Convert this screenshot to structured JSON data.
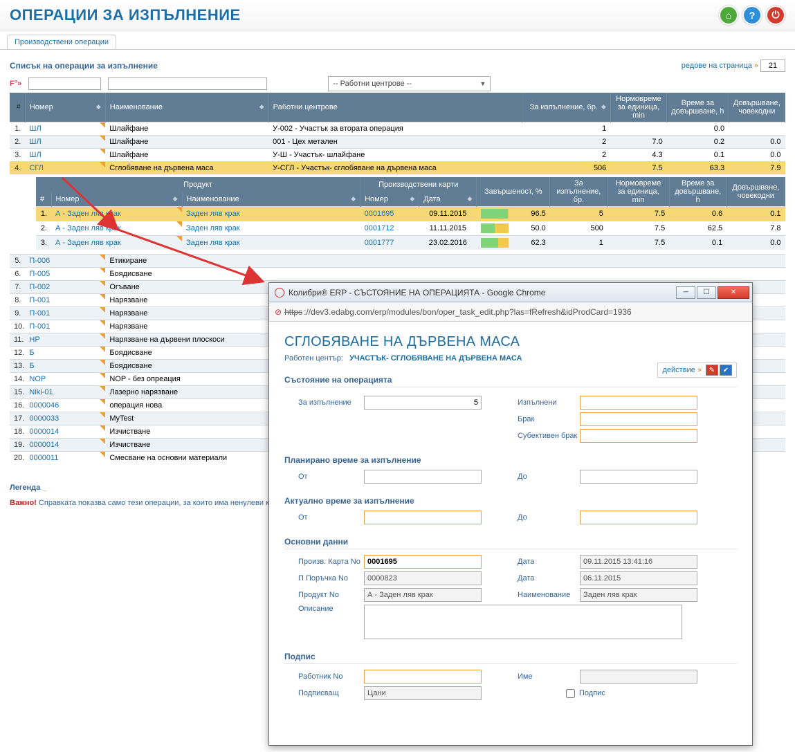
{
  "header": {
    "title": "ОПЕРАЦИИ ЗА ИЗПЪЛНЕНИЕ",
    "icons": {
      "home": "⌂",
      "help": "?",
      "power": "⏻"
    }
  },
  "tab": "Производствени операции",
  "subtitle": "Списък на операции за изпълнение",
  "rows_per_page": {
    "label": "редове на страница",
    "caret": "»",
    "value": "21"
  },
  "filters": {
    "label": "F°»",
    "work_center_placeholder": "-- Работни центрове --"
  },
  "main_columns": {
    "idx": "#",
    "number": "Номер",
    "name": "Наименование",
    "work_centers": "Работни центрове",
    "qty": "За изпълнение, бр.",
    "norm_time": "Нормовреме за единица, min",
    "finish_time": "Време за довършване, h",
    "finish_md": "Довършване, човекодни"
  },
  "main_rows": [
    {
      "idx": "1.",
      "num": "ШЛ",
      "name": "Шлайфане",
      "wc": "У-002 - Участък за втората операция",
      "qty": "1",
      "norm": "",
      "ft": "0.0",
      "md": ""
    },
    {
      "idx": "2.",
      "num": "ШЛ",
      "name": "Шлайфане",
      "wc": "001 - Цех метален",
      "qty": "2",
      "norm": "7.0",
      "ft": "0.2",
      "md": "0.0"
    },
    {
      "idx": "3.",
      "num": "ШЛ",
      "name": "Шлайфане",
      "wc": "У-Ш - Участък- шлайфане",
      "qty": "2",
      "norm": "4.3",
      "ft": "0.1",
      "md": "0.0"
    },
    {
      "idx": "4.",
      "num": "СГЛ",
      "name": "Сглобяване на дървена маса",
      "wc": "У-СГЛ - Участък- сглобяване на дървена маса",
      "qty": "506",
      "norm": "7.5",
      "ft": "63.3",
      "md": "7.9",
      "selected": true
    }
  ],
  "nested_columns": {
    "product": "Продукт",
    "cards": "Производствени карти",
    "idx": "#",
    "number": "Номер",
    "name": "Наименование",
    "card_no": "Номер",
    "date": "Дата",
    "pct": "Завършеност, %",
    "qty": "За изпълнение, бр.",
    "norm": "Нормовреме за единица, min",
    "ft": "Време за довършване, h",
    "md": "Довършване, човекодни"
  },
  "nested_rows": [
    {
      "idx": "1.",
      "pnum": "А - Заден ляв крак",
      "pname": "Заден ляв крак",
      "cnum": "0001695",
      "date": "09.11.2015",
      "pct": "96.5",
      "pct_fill": 97,
      "qty": "5",
      "norm": "7.5",
      "ft": "0.6",
      "md": "0.1",
      "selected": true
    },
    {
      "idx": "2.",
      "pnum": "А - Заден ляв крак",
      "pname": "Заден ляв крак",
      "cnum": "0001712",
      "date": "11.11.2015",
      "pct": "50.0",
      "pct_fill": 50,
      "qty": "500",
      "norm": "7.5",
      "ft": "62.5",
      "md": "7.8"
    },
    {
      "idx": "3.",
      "pnum": "А - Заден ляв крак",
      "pname": "Заден ляв крак",
      "cnum": "0001777",
      "date": "23.02.2016",
      "pct": "62.3",
      "pct_fill": 62,
      "qty": "1",
      "norm": "7.5",
      "ft": "0.1",
      "md": "0.0"
    }
  ],
  "tail_rows": [
    {
      "idx": "5.",
      "num": "П-006",
      "name": "Етикиране"
    },
    {
      "idx": "6.",
      "num": "П-005",
      "name": "Боядисване"
    },
    {
      "idx": "7.",
      "num": "П-002",
      "name": "Огъване"
    },
    {
      "idx": "8.",
      "num": "П-001",
      "name": "Нарязване"
    },
    {
      "idx": "9.",
      "num": "П-001",
      "name": "Нарязване"
    },
    {
      "idx": "10.",
      "num": "П-001",
      "name": "Нарязване"
    },
    {
      "idx": "11.",
      "num": "НР",
      "name": "Нарязване на дървени плоскоси"
    },
    {
      "idx": "12.",
      "num": "Б",
      "name": "Боядисване"
    },
    {
      "idx": "13.",
      "num": "Б",
      "name": "Боядисване"
    },
    {
      "idx": "14.",
      "num": "NOP",
      "name": "NOP - без опреация"
    },
    {
      "idx": "15.",
      "num": "Niki-01",
      "name": "Лазерно нарязване"
    },
    {
      "idx": "16.",
      "num": "0000046",
      "name": "операция нова"
    },
    {
      "idx": "17.",
      "num": "0000033",
      "name": "MyTest"
    },
    {
      "idx": "18.",
      "num": "0000014",
      "name": "Изчистване"
    },
    {
      "idx": "19.",
      "num": "0000014",
      "name": "Изчистване"
    },
    {
      "idx": "20.",
      "num": "0000011",
      "name": "Смесване на основни материали"
    }
  ],
  "legend": {
    "label": "Легенда",
    "bar": "_"
  },
  "note": {
    "strong": "Важно!",
    "text": "Справката показва само тези операции, за които има ненулеви к"
  },
  "popup": {
    "title": "Колибри® ERP - СЪСТОЯНИЕ НА ОПЕРАЦИЯТА - Google Chrome",
    "https": "https",
    "url": "://dev3.edabg.com/erp/modules/bon/oper_task_edit.php?las=fRefresh&idProdCard=1936",
    "op_title": "СГЛОБЯВАНЕ НА ДЪРВЕНА МАСА",
    "wc_label": "Работен център:",
    "wc_value": "УЧАСТЪК- СГЛОБЯВАНЕ НА ДЪРВЕНА МАСА",
    "sections": {
      "status": "Състояние на операцията",
      "planned": "Планирано време за изпълнение",
      "actual": "Актуално време за изпълнение",
      "basic": "Основни данни",
      "sign": "Подпис"
    },
    "action": {
      "label": "действие",
      "caret": "»"
    },
    "fields": {
      "to_exec": "За изпълнение",
      "to_exec_val": "5",
      "done": "Изпълнени",
      "scrap": "Брак",
      "subj_scrap": "Субективен брак",
      "from": "От",
      "to": "До",
      "card_no_l": "Произв. Карта No",
      "card_no_v": "0001695",
      "date_l": "Дата",
      "date_v": "09.11.2015 13:41:16",
      "order_no_l": "П Поръчка No",
      "order_no_v": "0000823",
      "order_date_v": "06.11.2015",
      "prod_no_l": "Продукт No",
      "prod_no_v": "А - Заден ляв крак",
      "prod_name_l": "Наименование",
      "prod_name_v": "Заден ляв крак",
      "desc_l": "Описание",
      "worker_no_l": "Работник No",
      "worker_name_l": "Име",
      "signer_l": "Подписващ",
      "signer_v": "Цани",
      "sign_l": "Подпис"
    }
  }
}
